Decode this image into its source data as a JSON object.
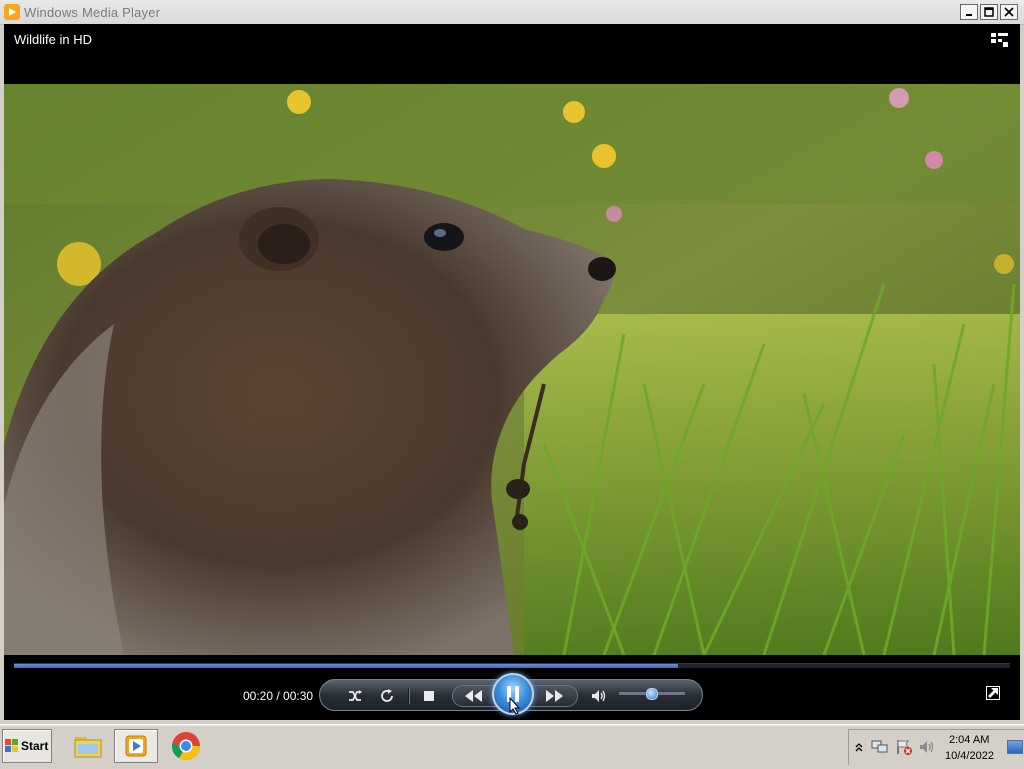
{
  "window": {
    "title": "Windows Media Player"
  },
  "player": {
    "media_title": "Wildlife in HD",
    "time_display": "00:20 / 00:30",
    "progress": 0.667,
    "volume_level": 0.48,
    "state": "playing"
  },
  "controls": {
    "icons": [
      "shuffle-icon",
      "repeat-icon",
      "stop-icon",
      "previous-icon",
      "pause-icon",
      "next-icon",
      "volume-icon",
      "fullscreen-icon",
      "switch-to-library-icon"
    ]
  },
  "taskbar": {
    "start_label": "Start",
    "clock_time": "2:04 AM",
    "clock_date": "10/4/2022",
    "items": [
      "file-explorer",
      "windows-media-player",
      "google-chrome"
    ]
  },
  "colors": {
    "accent": "#3c67c2",
    "player_bg": "#000000",
    "taskbar_bg": "#d4d0c8"
  }
}
